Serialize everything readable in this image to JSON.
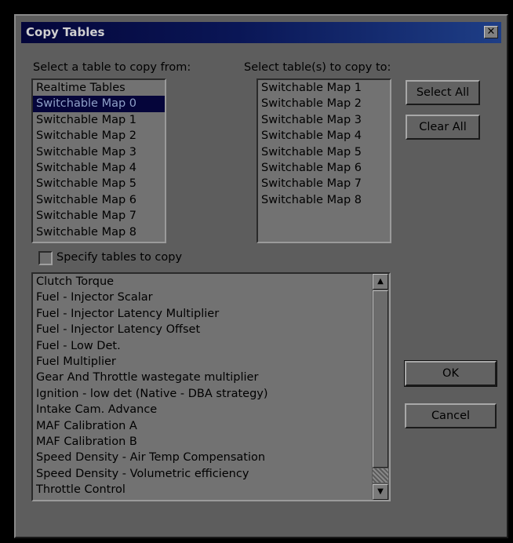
{
  "dialog": {
    "title": "Copy Tables",
    "close_glyph": "✕"
  },
  "source": {
    "label": "Select a table to copy from:",
    "items": [
      "Realtime Tables",
      "Switchable Map 0",
      "Switchable Map 1",
      "Switchable Map 2",
      "Switchable Map 3",
      "Switchable Map 4",
      "Switchable Map 5",
      "Switchable Map 6",
      "Switchable Map 7",
      "Switchable Map 8"
    ],
    "selected_index": 1
  },
  "target": {
    "label": "Select table(s) to copy to:",
    "items": [
      "Switchable Map 1",
      "Switchable Map 2",
      "Switchable Map 3",
      "Switchable Map 4",
      "Switchable Map 5",
      "Switchable Map 6",
      "Switchable Map 7",
      "Switchable Map 8"
    ]
  },
  "buttons": {
    "select_all": "Select All",
    "clear_all": "Clear All",
    "ok": "OK",
    "cancel": "Cancel"
  },
  "specify": {
    "label": "Specify tables to copy",
    "checked": false
  },
  "tables": {
    "items": [
      "Clutch Torque",
      "Fuel - Injector Scalar",
      "Fuel - Injector Latency Multiplier",
      "Fuel - Injector Latency Offset",
      "Fuel - Low Det.",
      "Fuel Multiplier",
      "Gear And Throttle wastegate multiplier",
      "Ignition - low det (Native - DBA strategy)",
      "Intake Cam. Advance",
      "MAF Calibration A",
      "MAF Calibration B",
      "Speed Density - Air Temp Compensation",
      "Speed Density - Volumetric efficiency",
      "Throttle Control"
    ]
  },
  "icons": {
    "scroll_up": "scroll-up-arrow",
    "scroll_down": "scroll-down-arrow"
  }
}
